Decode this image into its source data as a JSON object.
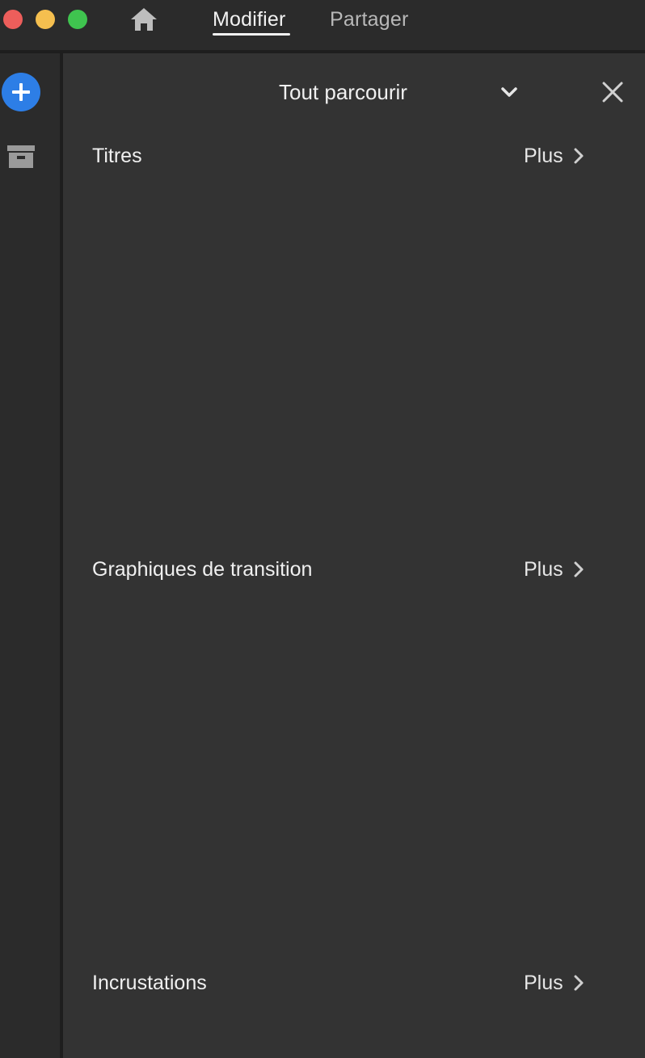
{
  "titlebar": {
    "tabs": [
      {
        "label": "Modifier",
        "active": true
      },
      {
        "label": "Partager",
        "active": false
      }
    ],
    "icons": [
      "close-window",
      "minimize-window",
      "maximize-window",
      "home-icon"
    ]
  },
  "rail": {
    "icons": [
      "add-icon",
      "archive-icon"
    ],
    "accent": "#2d7ee6"
  },
  "panel": {
    "title": "Tout parcourir",
    "sections": [
      {
        "title": "Titres",
        "more_label": "Plus"
      },
      {
        "title": "Graphiques de transition",
        "more_label": "Plus"
      },
      {
        "title": "Incrustations",
        "more_label": "Plus"
      }
    ]
  },
  "colors": {
    "background": "#2b2b2b",
    "panel": "#333333",
    "traffic_close": "#ed5e5b",
    "traffic_min": "#f5bf4f",
    "traffic_max": "#3fc44f"
  }
}
